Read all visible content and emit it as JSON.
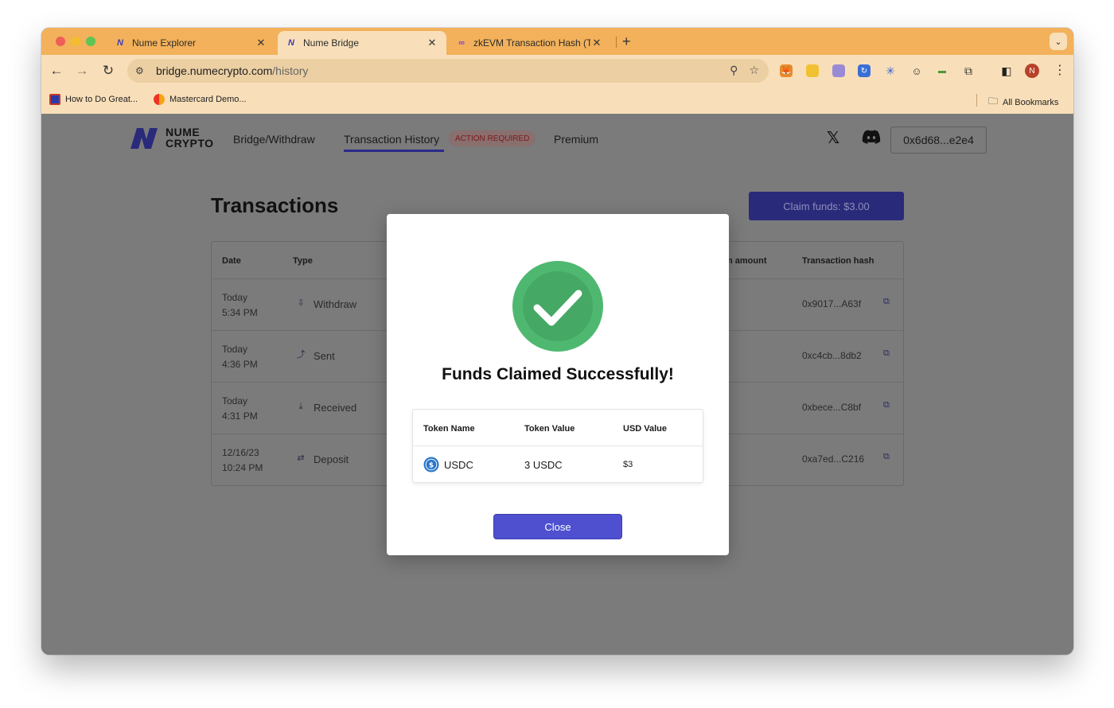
{
  "browser": {
    "tabs": [
      {
        "title": "Nume Explorer",
        "close": "✕"
      },
      {
        "title": "Nume Bridge",
        "close": "✕"
      },
      {
        "title": "zkEVM Transaction Hash (Txh",
        "close": "✕"
      }
    ],
    "new_tab": "+",
    "url_host": "bridge.numecrypto.com",
    "url_path": "/history",
    "profile_initial": "N",
    "bookmarks": [
      {
        "label": "How to Do Great..."
      },
      {
        "label": "Mastercard Demo..."
      }
    ],
    "all_bookmarks": "All Bookmarks"
  },
  "site": {
    "logo_line1": "NUME",
    "logo_line2": "CRYPTO",
    "nav": {
      "bridge": "Bridge/Withdraw",
      "history": "Transaction History",
      "badge": "ACTION REQUIRED",
      "premium": "Premium"
    },
    "wallet": "0x6d68...e2e4"
  },
  "main": {
    "heading": "Transactions",
    "claim_button": "Claim funds: $3.00",
    "table": {
      "headers": {
        "date": "Date",
        "type": "Type",
        "amount": "n amount",
        "hash": "Transaction hash"
      },
      "rows": [
        {
          "day": "Today",
          "time": "5:34 PM",
          "type": "Withdraw",
          "hash": "0x9017...A63f"
        },
        {
          "day": "Today",
          "time": "4:36 PM",
          "type": "Sent",
          "hash": "0xc4cb...8db2"
        },
        {
          "day": "Today",
          "time": "4:31 PM",
          "type": "Received",
          "hash": "0xbece...C8bf"
        },
        {
          "day": "12/16/23",
          "time": "10:24 PM",
          "type": "Deposit",
          "hash": "0xa7ed...C216"
        }
      ]
    }
  },
  "modal": {
    "title": "Funds Claimed Successfully!",
    "headers": {
      "name": "Token Name",
      "value": "Token Value",
      "usd": "USD Value"
    },
    "row": {
      "name": "USDC",
      "value": "3 USDC",
      "usd": "$3"
    },
    "close_label": "Close"
  },
  "colors": {
    "tab_strip": "#f2b15a",
    "toolbar": "#f8dfb9",
    "success_green": "#4fb870",
    "close_button": "#4e50d0"
  }
}
